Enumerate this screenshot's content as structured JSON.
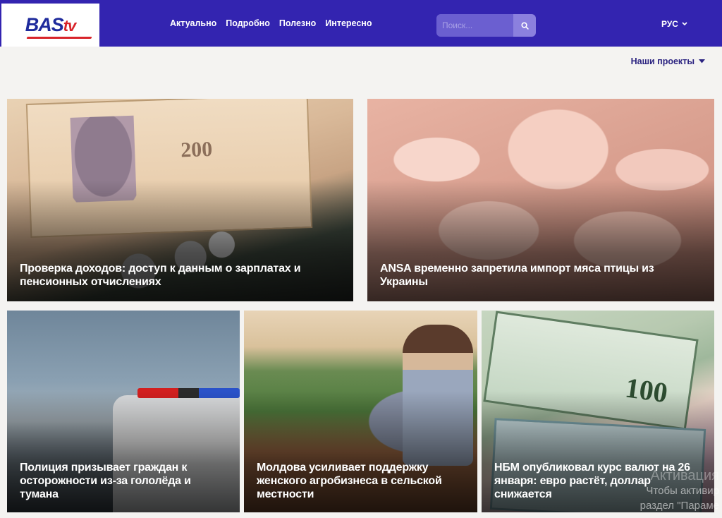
{
  "header": {
    "logo": {
      "main": "BAS",
      "accent": "tv"
    },
    "nav": [
      {
        "label": "Актуально"
      },
      {
        "label": "Подробно"
      },
      {
        "label": "Полезно"
      },
      {
        "label": "Интересно"
      }
    ],
    "search": {
      "placeholder": "Поиск...",
      "icon": "search-icon"
    },
    "language": {
      "label": "РУС",
      "icon": "chevron-down-icon"
    }
  },
  "projects": {
    "label": "Наши проекты",
    "icon": "caret-down-icon"
  },
  "articles": [
    {
      "title": "Проверка доходов: доступ к данным о зарплатах и пенсионных отчислениях",
      "banknote_value": "200"
    },
    {
      "title": "ANSA временно запретила импорт мяса птицы из Украины"
    },
    {
      "title": "Полиция призывает граждан к осторожности из-за гололёда и тумана"
    },
    {
      "title": "Молдова усиливает поддержку женского агробизнеса в сельской местности"
    },
    {
      "title": "НБМ опубликовал курс валют на 26 января: евро растёт, доллар снижается",
      "banknote_value": "100"
    }
  ],
  "watermark": {
    "line1": "Активация",
    "line2": "Чтобы активир",
    "line3": "раздел \"Параме"
  },
  "colors": {
    "header_bg": "#3324b0",
    "page_bg": "#f4f3f1",
    "accent_red": "#d8242a"
  }
}
